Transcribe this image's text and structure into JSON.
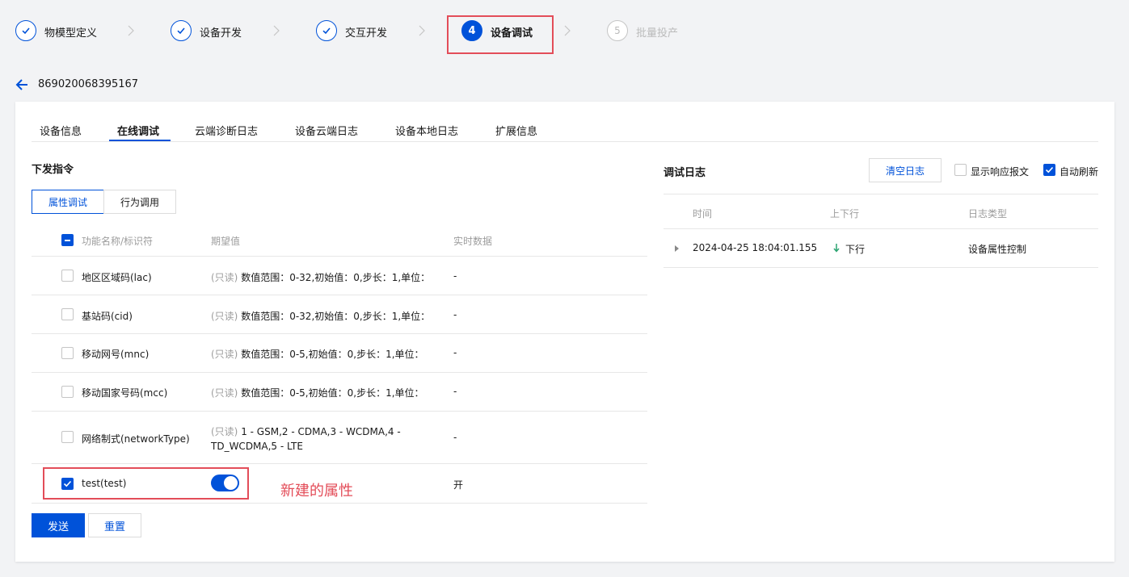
{
  "steps": [
    {
      "label": "物模型定义",
      "state": "done"
    },
    {
      "label": "设备开发",
      "state": "done"
    },
    {
      "label": "交互开发",
      "state": "done"
    },
    {
      "label": "设备调试",
      "state": "active",
      "number": "4"
    },
    {
      "label": "批量投产",
      "state": "disabled",
      "number": "5"
    }
  ],
  "header": {
    "device_id": "869020068395167"
  },
  "tabs": [
    "设备信息",
    "在线调试",
    "云端诊断日志",
    "设备云端日志",
    "设备本地日志",
    "扩展信息"
  ],
  "command": {
    "title": "下发指令",
    "segments": [
      "属性调试",
      "行为调用"
    ],
    "columns": [
      "功能名称/标识符",
      "期望值",
      "实时数据"
    ],
    "rows": [
      {
        "name": "地区区域码(lac)",
        "readonly": "(只读)",
        "expect": "数值范围：0-32,初始值：0,步长：1,单位：",
        "realtime": "-"
      },
      {
        "name": "基站码(cid)",
        "readonly": "(只读)",
        "expect": "数值范围：0-32,初始值：0,步长：1,单位：",
        "realtime": "-"
      },
      {
        "name": "移动网号(mnc)",
        "readonly": "(只读)",
        "expect": "数值范围：0-5,初始值：0,步长：1,单位：",
        "realtime": "-"
      },
      {
        "name": "移动国家号码(mcc)",
        "readonly": "(只读)",
        "expect": "数值范围：0-5,初始值：0,步长：1,单位：",
        "realtime": "-"
      },
      {
        "name": "网络制式(networkType)",
        "readonly": "(只读)",
        "expect_line1": "1 - GSM,2 - CDMA,3 - WCDMA,4 -",
        "expect_line2": "TD_WCDMA,5 - LTE",
        "realtime": "-"
      },
      {
        "name": "test(test)",
        "toggle_on": true,
        "realtime": "开"
      }
    ],
    "annotation": "新建的属性",
    "send_label": "发送",
    "reset_label": "重置"
  },
  "log": {
    "title": "调试日志",
    "clear_label": "清空日志",
    "show_response_label": "显示响应报文",
    "auto_refresh_label": "自动刷新",
    "columns": [
      "时间",
      "上下行",
      "日志类型"
    ],
    "rows": [
      {
        "time": "2024-04-25 18:04:01.155",
        "direction": "下行",
        "type": "设备属性控制"
      }
    ]
  },
  "colors": {
    "brand": "#0052d9",
    "annotation": "#e34d59",
    "down_arrow": "#2ba471"
  }
}
